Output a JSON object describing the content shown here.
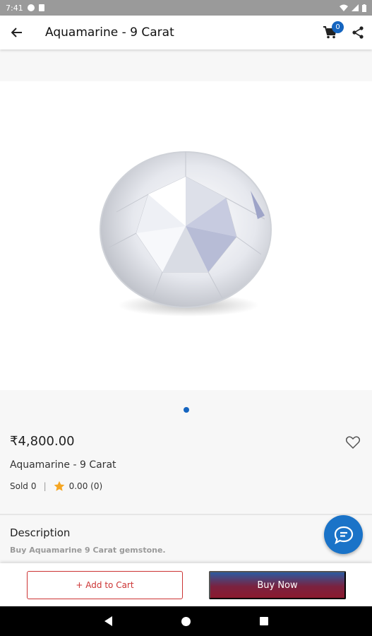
{
  "status_bar": {
    "time": "7:41"
  },
  "app_bar": {
    "title": "Aquamarine - 9 Carat",
    "cart_count": "0"
  },
  "product": {
    "price": "₹4,800.00",
    "name": "Aquamarine - 9 Carat",
    "sold_label": "Sold",
    "sold_count": "0",
    "rating": "0.00 (0)"
  },
  "description": {
    "title": "Description",
    "text": "Buy Aquamarine 9 Carat gemstone."
  },
  "actions": {
    "add_to_cart": "+ Add to Cart",
    "buy_now": "Buy Now"
  },
  "colors": {
    "accent": "#1565c0",
    "star": "#f5a623",
    "add_cart": "#cc3333"
  }
}
